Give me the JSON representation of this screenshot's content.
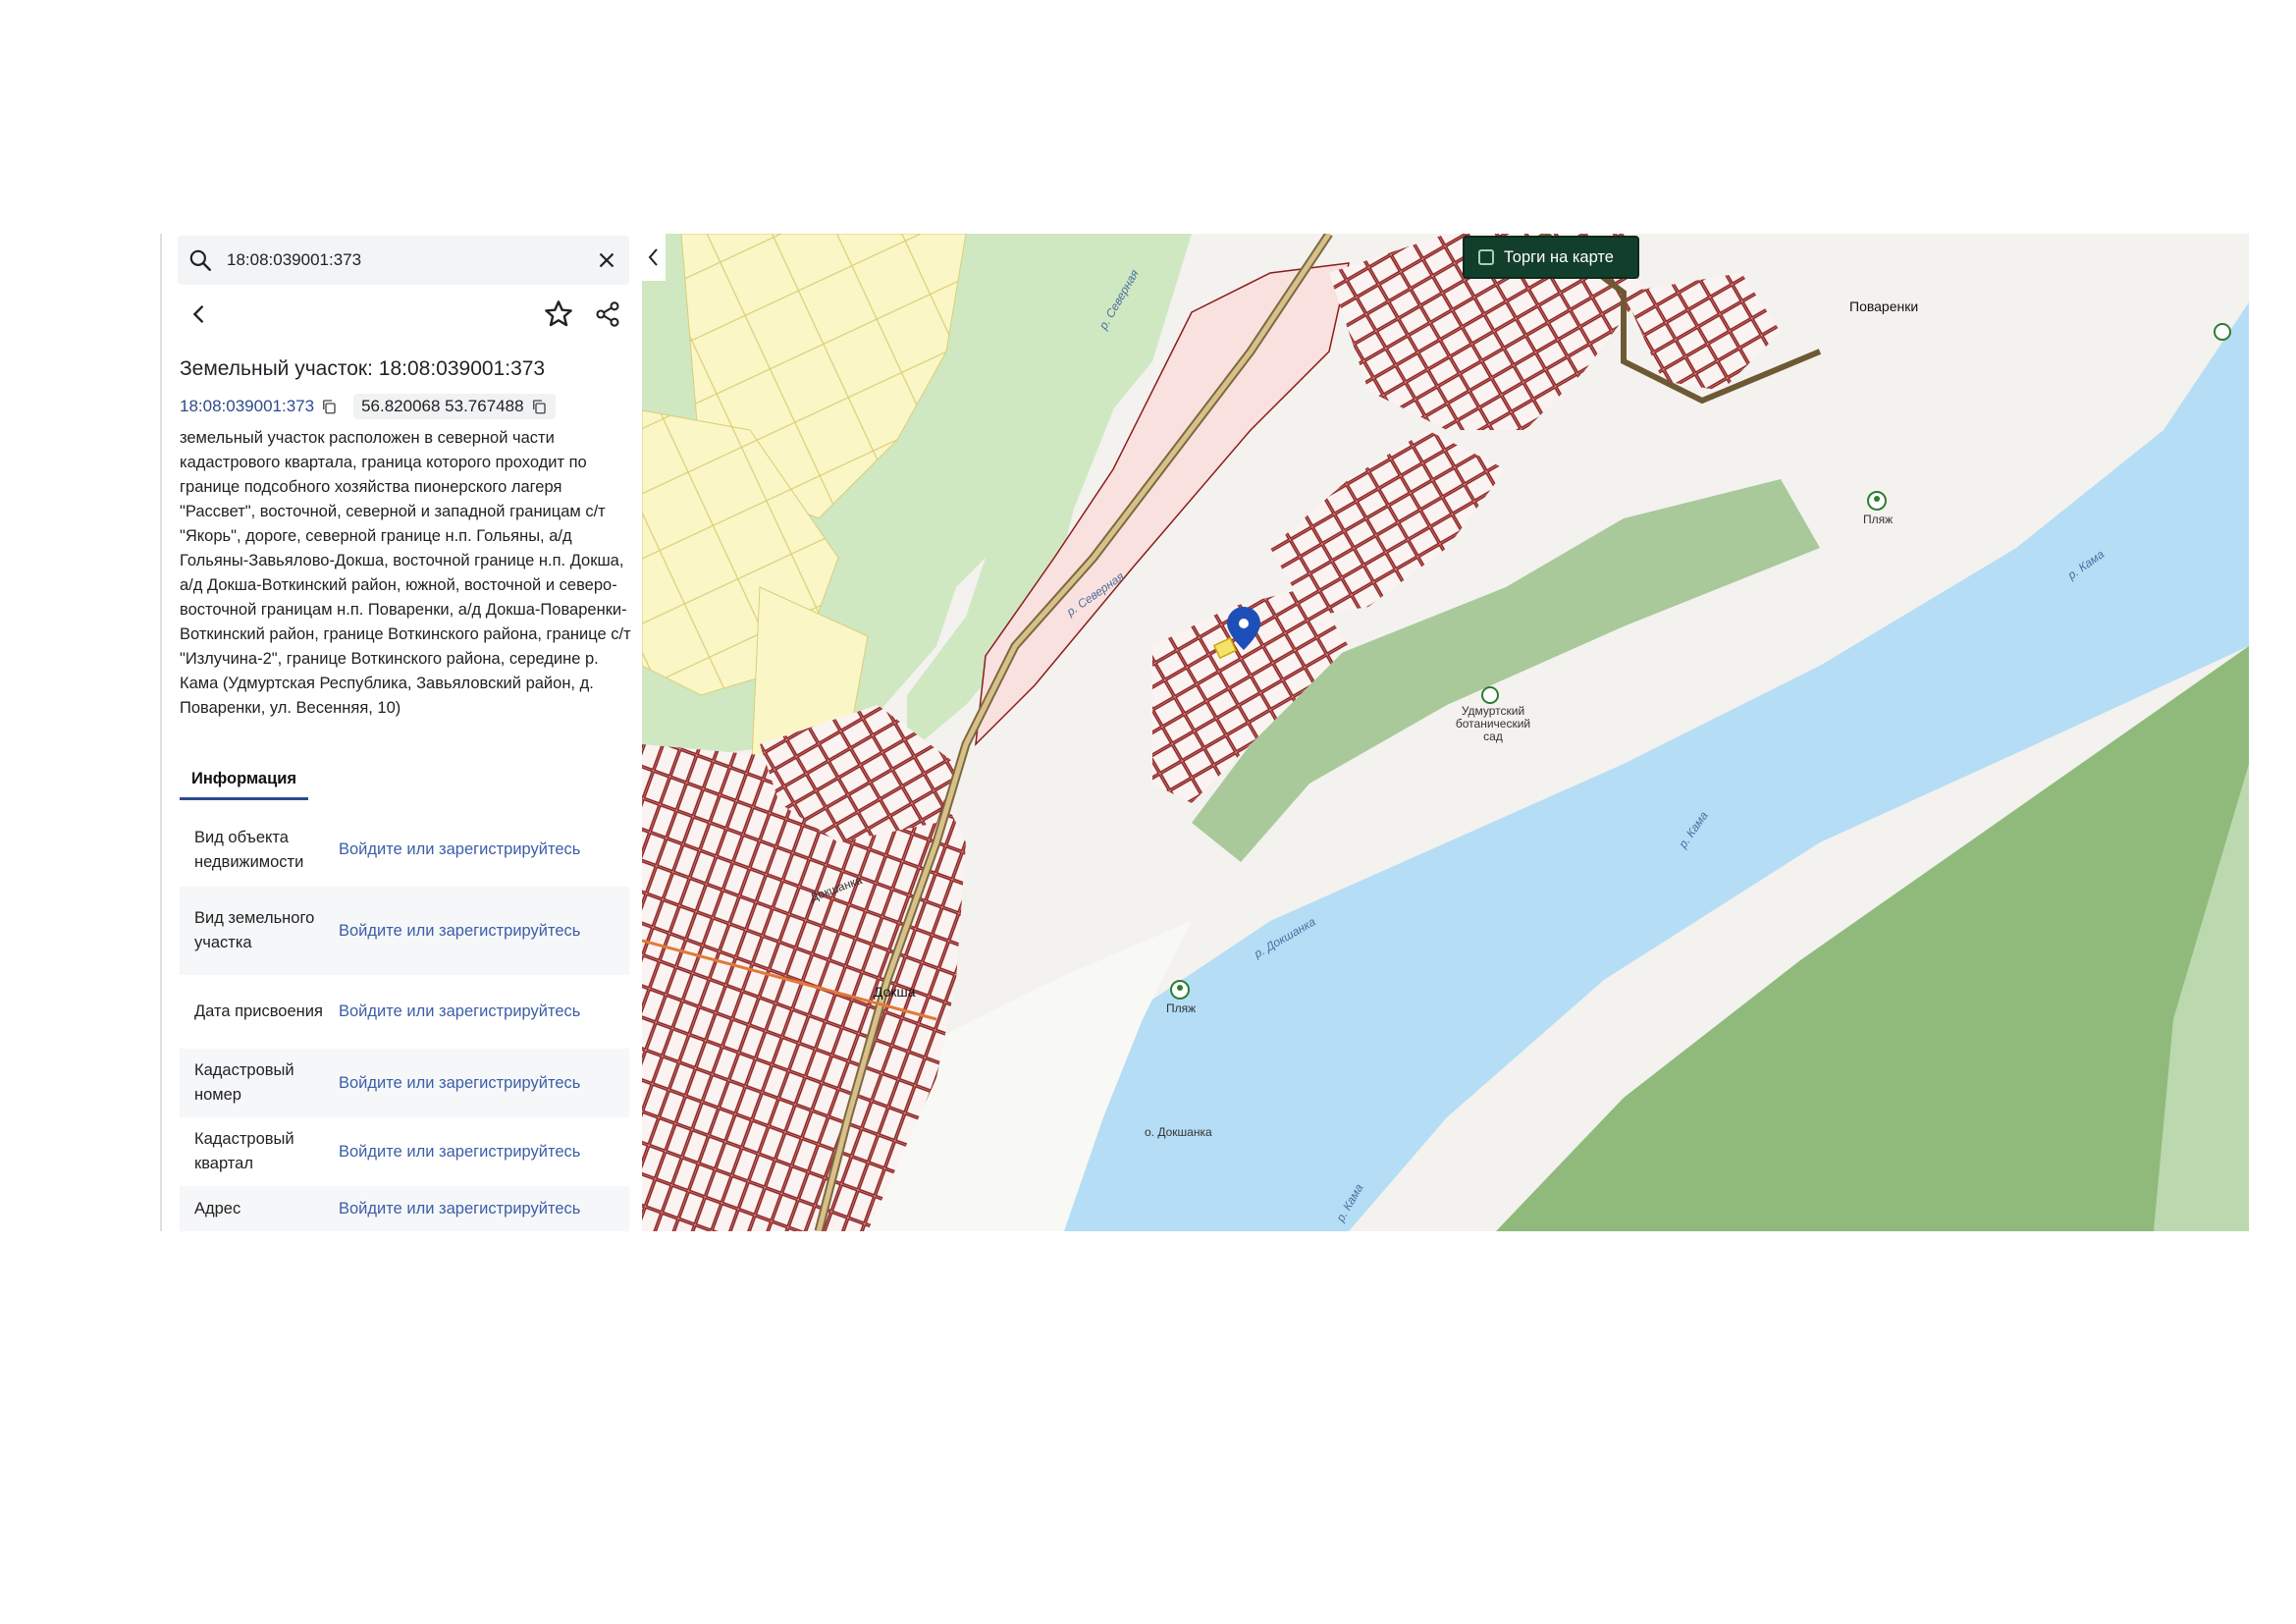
{
  "search": {
    "value": "18:08:039001:373"
  },
  "object": {
    "title": "Земельный участок: 18:08:039001:373",
    "cadastral_number": "18:08:039001:373",
    "coordinates": "56.820068 53.767488",
    "description": "земельный участок расположен в северной части кадастрового квартала, граница которого проходит по границе подсобного хозяйства пионерского лагеря \"Рассвет\", восточной, северной и западной границам с/т \"Якорь\", дороге, северной границе н.п. Гольяны, а/д Гольяны-Завьялово-Докша, восточной границе н.п. Докша, а/д Докша-Воткинский район, южной, восточной и северо-восточной границам н.п. Поваренки, а/д Докша-Поваренки-Воткинский район, границе Воткинского района, границе с/т \"Излучина-2\", границе Воткинского района, середине р. Кама (Удмуртская Республика, Завьяловский район, д. Поваренки, ул. Весенняя, 10)"
  },
  "tabs": [
    {
      "label": "Информация"
    }
  ],
  "info_rows": [
    {
      "key": "Вид объекта недвижимости",
      "value": "Войдите или зарегистрируйтесь"
    },
    {
      "key": "Вид земельного участка",
      "value": "Войдите или зарегистрируйтесь"
    },
    {
      "key": "Дата присвоения",
      "value": "Войдите или зарегистрируйтесь"
    },
    {
      "key": "Кадастровый номер",
      "value": "Войдите или зарегистрируйтесь"
    },
    {
      "key": "Кадастровый квартал",
      "value": "Войдите или зарегистрируйтесь"
    },
    {
      "key": "Адрес",
      "value": "Войдите или зарегистрируйтесь"
    }
  ],
  "map": {
    "toggle_label": "Торги на карте",
    "labels": {
      "povarenki": "Поваренки",
      "doksha": "Докша",
      "garden": "Удмуртский ботанический сад",
      "beach1": "Пляж",
      "beach2": "Пляж",
      "kama1": "р. Кама",
      "kama2": "р. Кама",
      "kama3": "р. Кама",
      "severnaya1": "р. Северная",
      "severnaya2": "р. Северная",
      "dokshanka_r": "р. Докшанка",
      "dokshanka_isl": "о. Докшанка",
      "dokshanka_st": "Докшанка"
    },
    "colors": {
      "water": "#b5ddf6",
      "forest": "#8fba7c",
      "meadow": "#cfe8c2",
      "fields": "#fbf6c6",
      "plot_border": "#8b1c1c",
      "marker": "#1d4fb8"
    }
  }
}
